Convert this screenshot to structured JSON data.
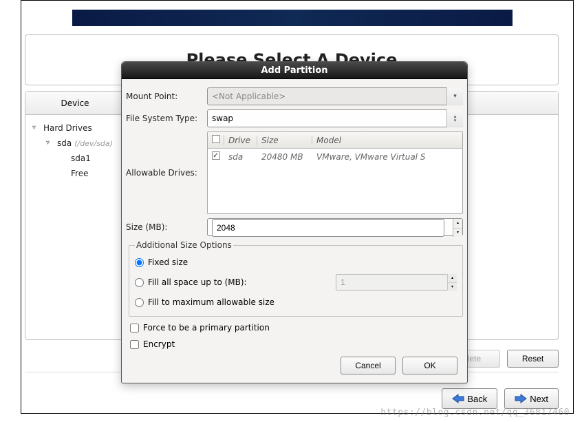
{
  "page": {
    "title": "Please Select A Device"
  },
  "columns": {
    "device": "Device"
  },
  "tree": {
    "root": "Hard Drives",
    "disk": "sda",
    "disk_meta": "(/dev/sda)",
    "parts": {
      "p1": "sda1",
      "free": "Free"
    }
  },
  "toolbar_under": {
    "delete": "lete",
    "reset": "Reset"
  },
  "nav": {
    "back": "Back",
    "next": "Next"
  },
  "dialog": {
    "title": "Add Partition",
    "labels": {
      "mount_point": "Mount Point:",
      "fs_type": "File System Type:",
      "allowable_drives": "Allowable Drives:",
      "size_mb": "Size (MB):",
      "additional": "Additional Size Options"
    },
    "mount_point_value": "<Not Applicable>",
    "fs_type_value": "swap",
    "drives": {
      "headers": {
        "drive": "Drive",
        "size": "Size",
        "model": "Model"
      },
      "row": {
        "drive": "sda",
        "size": "20480 MB",
        "model": "VMware, VMware Virtual S",
        "checked": true
      }
    },
    "size_value": "2048",
    "radios": {
      "fixed": "Fixed size",
      "fill_up_to": "Fill all space up to (MB):",
      "fill_up_value": "1",
      "fill_max": "Fill to maximum allowable size"
    },
    "checks": {
      "primary": "Force to be a primary partition",
      "encrypt": "Encrypt"
    },
    "buttons": {
      "cancel": "Cancel",
      "ok": "OK"
    }
  },
  "watermark": "https://blog.csdn.net/qq_36817460"
}
